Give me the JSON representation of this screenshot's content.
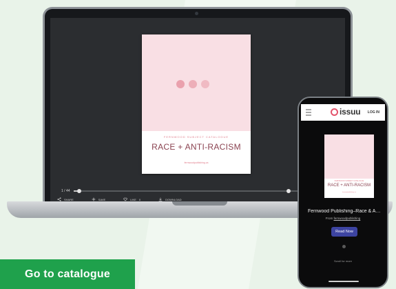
{
  "laptop": {
    "document": {
      "subtitle": "FERNWOOD SUBJECT CATALOGUE",
      "title": "RACE + ANTI-RACISM",
      "url": "fernwoodpublishing.ca"
    },
    "viewer": {
      "page_indicator": "1 / 44",
      "progress": 0.02,
      "secondary_knob": 0.82,
      "toolbar": {
        "share": "SHARE",
        "save": "SAVE",
        "like": "LIKE",
        "like_count": "0",
        "download": "DOWNLOAD"
      }
    }
  },
  "phone": {
    "header": {
      "menu_icon": "hamburger-icon",
      "logo_text": "issuu",
      "login": "LOG IN"
    },
    "document": {
      "subtitle": "FERNWOOD SUBJECT CATALOGUE",
      "title": "RACE + ANTI-RACISM",
      "url": "fernwoodpublishing.ca"
    },
    "publication_title": "Fernwood Publishing–Race & Anti-...",
    "from_label": "From",
    "from_name": "fernwoodpublishing",
    "read_button": "Read Now",
    "scroll_text": "Scroll for more"
  },
  "cta": {
    "label": "Go to catalogue"
  },
  "colors": {
    "background": "#e9f3e9",
    "cta": "#1fa14c",
    "read_button": "#3d44a1",
    "cover_pink": "#f9dfe4",
    "issuu_red": "#e3536b"
  }
}
